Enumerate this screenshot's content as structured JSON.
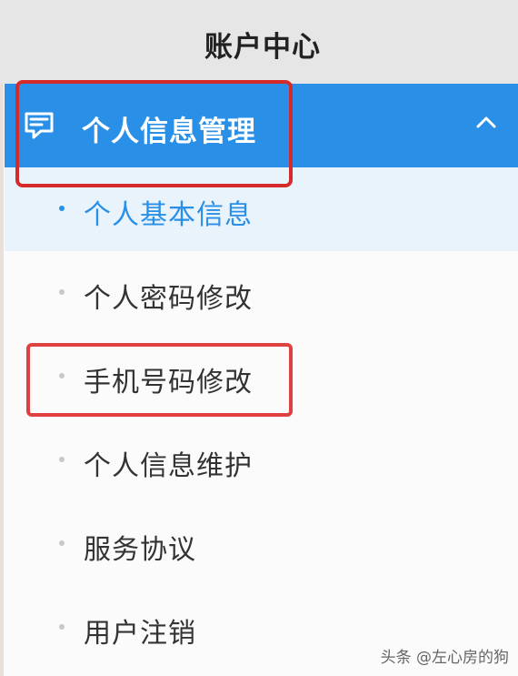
{
  "header": {
    "title": "账户中心"
  },
  "section": {
    "label": "个人信息管理",
    "icon": "message-list-icon",
    "expanded": true,
    "toggle_icon": "chevron-up-icon"
  },
  "menu": {
    "items": [
      {
        "label": "个人基本信息",
        "active": true
      },
      {
        "label": "个人密码修改",
        "active": false
      },
      {
        "label": "手机号码修改",
        "active": false
      },
      {
        "label": "个人信息维护",
        "active": false
      },
      {
        "label": "服务协议",
        "active": false
      },
      {
        "label": "用户注销",
        "active": false
      }
    ]
  },
  "watermark": {
    "text": "头条 @左心房的狗"
  },
  "colors": {
    "accent": "#2a8fe6",
    "header_bg": "#e6e6e6",
    "active_bg": "#e8f3fc",
    "annotation_red": "#d42a2a"
  }
}
